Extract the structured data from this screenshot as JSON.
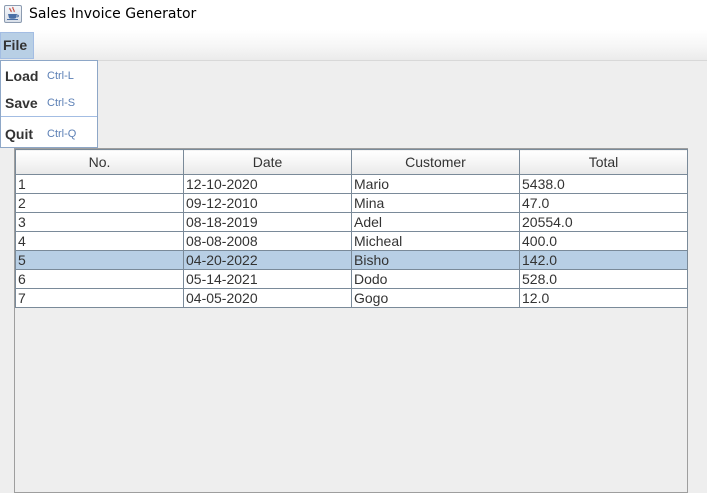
{
  "window": {
    "title": "Sales Invoice Generator",
    "icon": "java-cup-icon"
  },
  "menubar": {
    "file_label": "File"
  },
  "file_menu": {
    "items": [
      {
        "label": "Load",
        "accelerator": "Ctrl-L"
      },
      {
        "label": "Save",
        "accelerator": "Ctrl-S"
      },
      {
        "label": "Quit",
        "accelerator": "Ctrl-Q"
      }
    ]
  },
  "section": {
    "label_visible": "able"
  },
  "table": {
    "columns": [
      "No.",
      "Date",
      "Customer",
      "Total"
    ],
    "rows": [
      {
        "no": "1",
        "date": "12-10-2020",
        "customer": "Mario",
        "total": "5438.0"
      },
      {
        "no": "2",
        "date": "09-12-2010",
        "customer": "Mina",
        "total": "47.0"
      },
      {
        "no": "3",
        "date": "08-18-2019",
        "customer": "Adel",
        "total": "20554.0"
      },
      {
        "no": "4",
        "date": "08-08-2008",
        "customer": "Micheal",
        "total": "400.0"
      },
      {
        "no": "5",
        "date": "04-20-2022",
        "customer": "Bisho",
        "total": "142.0"
      },
      {
        "no": "6",
        "date": "05-14-2021",
        "customer": "Dodo",
        "total": "528.0"
      },
      {
        "no": "7",
        "date": "04-05-2020",
        "customer": "Gogo",
        "total": "12.0"
      }
    ],
    "selected_row": "5"
  },
  "colors": {
    "selection": "#b8cfe5",
    "accelerator_text": "#5b7fb5",
    "background": "#eeeeee"
  }
}
